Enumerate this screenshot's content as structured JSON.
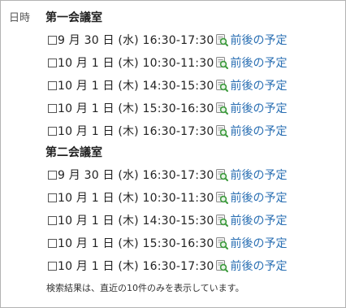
{
  "field": {
    "label": "日時"
  },
  "rooms": [
    {
      "name": "第一会議室",
      "slots": [
        {
          "time": "9 月 30 日 (水) 16:30-17:30",
          "link": "前後の予定"
        },
        {
          "time": "10 月 1 日 (木) 10:30-11:30",
          "link": "前後の予定"
        },
        {
          "time": "10 月 1 日 (木) 14:30-15:30",
          "link": "前後の予定"
        },
        {
          "time": "10 月 1 日 (木) 15:30-16:30",
          "link": "前後の予定"
        },
        {
          "time": "10 月 1 日 (木) 16:30-17:30",
          "link": "前後の予定"
        }
      ]
    },
    {
      "name": "第二会議室",
      "slots": [
        {
          "time": "9 月 30 日 (水) 16:30-17:30",
          "link": "前後の予定"
        },
        {
          "time": "10 月 1 日 (木) 10:30-11:30",
          "link": "前後の予定"
        },
        {
          "time": "10 月 1 日 (木) 14:30-15:30",
          "link": "前後の予定"
        },
        {
          "time": "10 月 1 日 (木) 15:30-16:30",
          "link": "前後の予定"
        },
        {
          "time": "10 月 1 日 (木) 16:30-17:30",
          "link": "前後の予定"
        }
      ]
    }
  ],
  "note": "検索結果は、直近の10件のみを表示しています。",
  "icons": {
    "schedule": "calendar-search-icon",
    "checkbox": "checkbox-icon"
  },
  "colors": {
    "link": "#2a6fb3",
    "border": "#b3b3b3",
    "icon_green": "#3c9a3c"
  }
}
